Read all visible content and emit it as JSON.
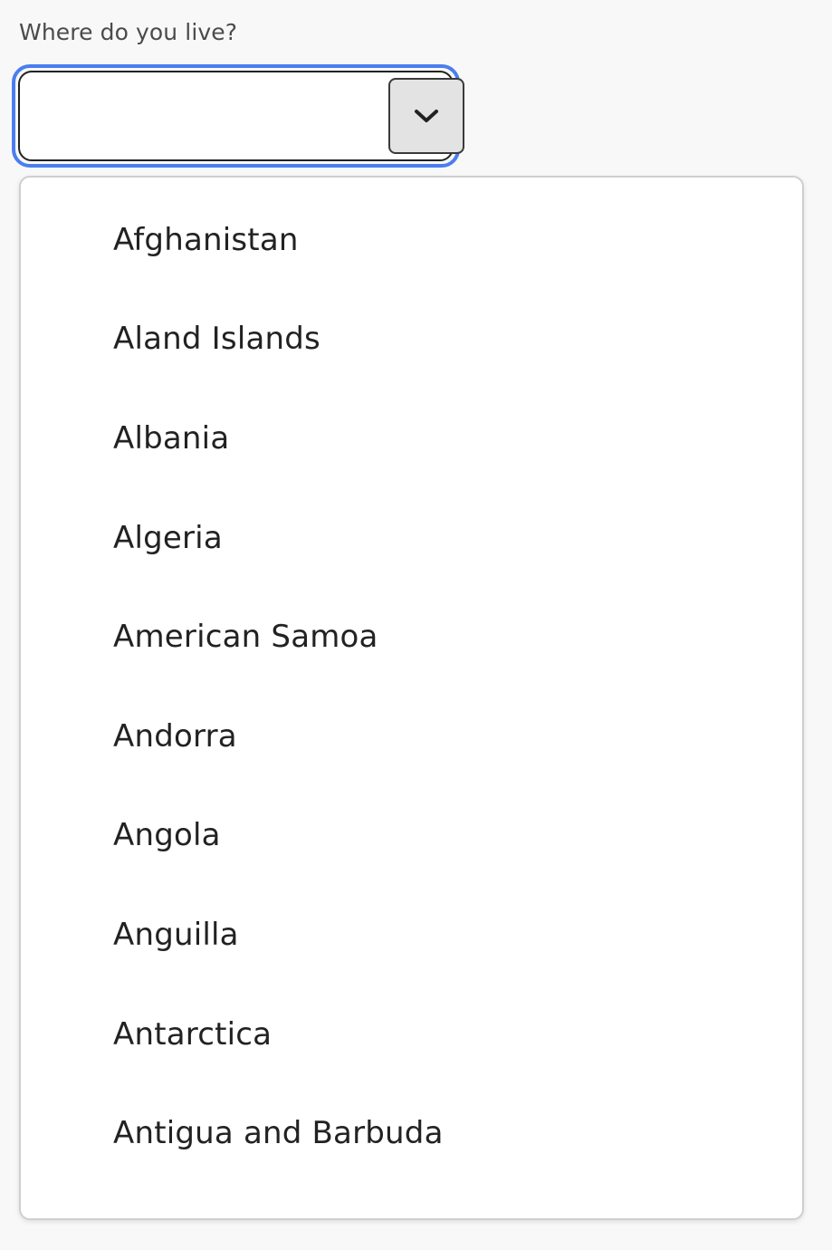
{
  "form": {
    "label": "Where do you live?",
    "input_value": "",
    "options": [
      "Afghanistan",
      "Aland Islands",
      "Albania",
      "Algeria",
      "American Samoa",
      "Andorra",
      "Angola",
      "Anguilla",
      "Antarctica",
      "Antigua and Barbuda"
    ]
  },
  "icons": {
    "toggle": "chevron-down-icon"
  },
  "colors": {
    "focus_ring": "#4a7ef0",
    "background": "#f8f8f8",
    "text": "#222222",
    "button_bg": "#e3e3e3"
  }
}
